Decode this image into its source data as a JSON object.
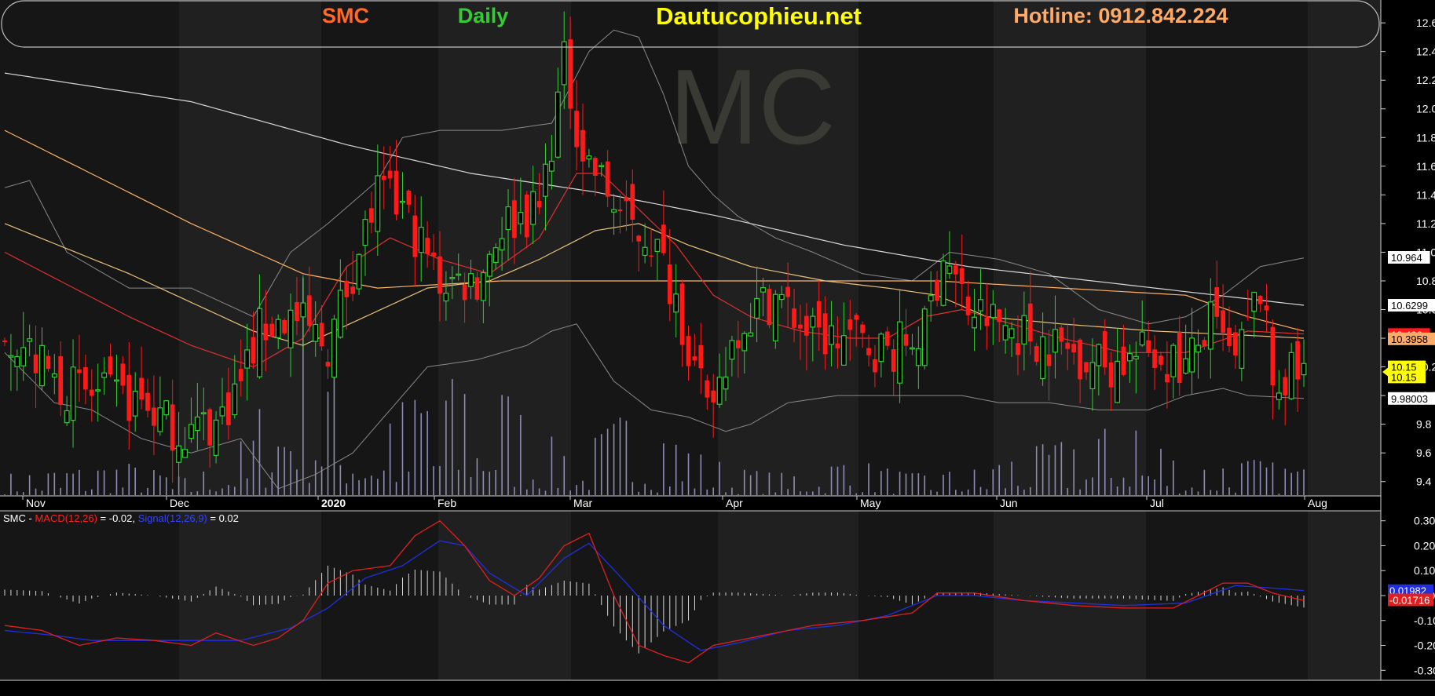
{
  "header": {
    "symbol": "SMC",
    "interval": "Daily",
    "site": "Dautucophieu.net",
    "hotline": "Hotline: 0912.842.224"
  },
  "watermark": "MC",
  "colors": {
    "symbol": "#ff6a2a",
    "interval": "#33cc33",
    "site": "#ffff00",
    "hotline": "#ffaa66",
    "up": "#33cc33",
    "down": "#ff1a1a",
    "ma_red": "#e03030",
    "ma_orange": "#ffb266",
    "ma_tan": "#e8c27a",
    "ma_white": "#d8d8d8",
    "bb": "#8a8a8a",
    "volume": "#8c8cb4",
    "macd": "#e02020",
    "signal": "#2030e0"
  },
  "chart_data": [
    {
      "type": "candlestick",
      "title": "SMC Daily",
      "x_labels": [
        "Nov",
        "Dec",
        "2020",
        "Feb",
        "Mar",
        "Apr",
        "May",
        "Jun",
        "Jul",
        "Aug"
      ],
      "ylim": [
        9.3,
        12.65
      ],
      "y_ticks": [
        "12.6",
        "12.4",
        "12.2",
        "12.0",
        "11.8",
        "11.6",
        "11.4",
        "11.2",
        "11.0",
        "10.8",
        "10.6",
        "10.4",
        "10.2",
        "10.0",
        "9.8",
        "9.6",
        "9.4"
      ],
      "price_labels": [
        {
          "text": "10.964",
          "value": 10.964,
          "bg": "#ffffff",
          "fg": "#000000"
        },
        {
          "text": "10.6299",
          "value": 10.6299,
          "bg": "#ffffff",
          "fg": "#000000"
        },
        {
          "text": "10.426",
          "value": 10.426,
          "bg": "#ff1a1a",
          "fg": "#ffffff"
        },
        {
          "text": "10.3958",
          "value": 10.3958,
          "bg": "#ffaa66",
          "fg": "#000000"
        },
        {
          "text": "10.15",
          "value": 10.2,
          "bg": "#ffff00",
          "fg": "#000000"
        },
        {
          "text": "10.15",
          "value": 10.13,
          "bg": "#ffff00",
          "fg": "#000000"
        },
        {
          "text": "9.98003",
          "value": 9.98003,
          "bg": "#ffffff",
          "fg": "#000000"
        }
      ],
      "series_anchors": {
        "close": [
          [
            0,
            10.5
          ],
          [
            8,
            10.1
          ],
          [
            14,
            10.0
          ],
          [
            22,
            9.95
          ],
          [
            28,
            9.75
          ],
          [
            34,
            9.8
          ],
          [
            38,
            10.1
          ],
          [
            41,
            10.45
          ],
          [
            46,
            10.55
          ],
          [
            52,
            10.35
          ],
          [
            55,
            10.75
          ],
          [
            60,
            11.4
          ],
          [
            64,
            11.3
          ],
          [
            70,
            10.8
          ],
          [
            76,
            10.8
          ],
          [
            80,
            11.2
          ],
          [
            86,
            11.3
          ],
          [
            90,
            12.3
          ],
          [
            93,
            11.7
          ],
          [
            100,
            11.2
          ],
          [
            104,
            11.1
          ],
          [
            108,
            10.7
          ],
          [
            110,
            10.35
          ],
          [
            113,
            9.85
          ],
          [
            118,
            10.5
          ],
          [
            124,
            10.7
          ],
          [
            130,
            10.4
          ],
          [
            136,
            10.4
          ],
          [
            142,
            10.3
          ],
          [
            148,
            10.45
          ],
          [
            151,
            11.0
          ],
          [
            155,
            10.6
          ],
          [
            160,
            10.5
          ],
          [
            166,
            10.4
          ],
          [
            172,
            10.3
          ],
          [
            178,
            10.2
          ],
          [
            184,
            10.3
          ],
          [
            190,
            10.2
          ],
          [
            194,
            10.5
          ],
          [
            198,
            10.2
          ],
          [
            202,
            10.75
          ],
          [
            204,
            10.1
          ],
          [
            209,
            10.15
          ]
        ],
        "ma20": [
          [
            0,
            11.0
          ],
          [
            20,
            10.55
          ],
          [
            30,
            10.35
          ],
          [
            40,
            10.2
          ],
          [
            48,
            10.4
          ],
          [
            55,
            10.9
          ],
          [
            62,
            11.1
          ],
          [
            70,
            10.95
          ],
          [
            78,
            10.85
          ],
          [
            86,
            11.1
          ],
          [
            92,
            11.55
          ],
          [
            96,
            11.55
          ],
          [
            102,
            11.3
          ],
          [
            108,
            11.05
          ],
          [
            114,
            10.7
          ],
          [
            120,
            10.55
          ],
          [
            128,
            10.45
          ],
          [
            136,
            10.4
          ],
          [
            142,
            10.4
          ],
          [
            148,
            10.55
          ],
          [
            154,
            10.6
          ],
          [
            162,
            10.5
          ],
          [
            170,
            10.4
          ],
          [
            180,
            10.3
          ],
          [
            190,
            10.3
          ],
          [
            200,
            10.45
          ],
          [
            209,
            10.43
          ]
        ],
        "ma50": [
          [
            0,
            11.2
          ],
          [
            20,
            10.85
          ],
          [
            40,
            10.45
          ],
          [
            48,
            10.35
          ],
          [
            58,
            10.55
          ],
          [
            68,
            10.75
          ],
          [
            78,
            10.8
          ],
          [
            86,
            10.95
          ],
          [
            95,
            11.15
          ],
          [
            102,
            11.2
          ],
          [
            110,
            11.05
          ],
          [
            120,
            10.9
          ],
          [
            132,
            10.8
          ],
          [
            142,
            10.75
          ],
          [
            150,
            10.7
          ],
          [
            158,
            10.55
          ],
          [
            170,
            10.5
          ],
          [
            185,
            10.45
          ],
          [
            200,
            10.42
          ],
          [
            209,
            10.4
          ]
        ],
        "ma100": [
          [
            0,
            11.85
          ],
          [
            30,
            11.2
          ],
          [
            48,
            10.85
          ],
          [
            60,
            10.75
          ],
          [
            80,
            10.8
          ],
          [
            95,
            10.8
          ],
          [
            110,
            10.8
          ],
          [
            130,
            10.8
          ],
          [
            150,
            10.8
          ],
          [
            170,
            10.75
          ],
          [
            190,
            10.7
          ],
          [
            200,
            10.55
          ],
          [
            209,
            10.45
          ]
        ],
        "ma200": [
          [
            0,
            12.25
          ],
          [
            30,
            12.05
          ],
          [
            55,
            11.75
          ],
          [
            75,
            11.55
          ],
          [
            95,
            11.42
          ],
          [
            115,
            11.25
          ],
          [
            135,
            11.05
          ],
          [
            155,
            10.9
          ],
          [
            175,
            10.8
          ],
          [
            195,
            10.7
          ],
          [
            209,
            10.63
          ]
        ],
        "bb_upper": [
          [
            0,
            11.45
          ],
          [
            4,
            11.5
          ],
          [
            10,
            11.0
          ],
          [
            20,
            10.75
          ],
          [
            30,
            10.75
          ],
          [
            40,
            10.55
          ],
          [
            46,
            11.0
          ],
          [
            52,
            11.2
          ],
          [
            60,
            11.5
          ],
          [
            64,
            11.8
          ],
          [
            70,
            11.85
          ],
          [
            80,
            11.85
          ],
          [
            88,
            11.9
          ],
          [
            94,
            12.4
          ],
          [
            98,
            12.55
          ],
          [
            102,
            12.5
          ],
          [
            106,
            12.1
          ],
          [
            110,
            11.6
          ],
          [
            114,
            11.4
          ],
          [
            118,
            11.25
          ],
          [
            124,
            11.1
          ],
          [
            130,
            11.0
          ],
          [
            138,
            10.85
          ],
          [
            146,
            10.8
          ],
          [
            152,
            11.0
          ],
          [
            160,
            10.95
          ],
          [
            168,
            10.85
          ],
          [
            176,
            10.6
          ],
          [
            184,
            10.5
          ],
          [
            190,
            10.55
          ],
          [
            196,
            10.7
          ],
          [
            202,
            10.9
          ],
          [
            209,
            10.96
          ]
        ],
        "bb_lower": [
          [
            0,
            10.3
          ],
          [
            8,
            9.95
          ],
          [
            14,
            9.9
          ],
          [
            22,
            9.7
          ],
          [
            30,
            9.6
          ],
          [
            38,
            9.7
          ],
          [
            44,
            9.35
          ],
          [
            50,
            9.45
          ],
          [
            56,
            9.6
          ],
          [
            62,
            9.9
          ],
          [
            68,
            10.2
          ],
          [
            76,
            10.25
          ],
          [
            84,
            10.35
          ],
          [
            88,
            10.45
          ],
          [
            92,
            10.5
          ],
          [
            98,
            10.1
          ],
          [
            104,
            9.9
          ],
          [
            110,
            9.85
          ],
          [
            116,
            9.75
          ],
          [
            120,
            9.8
          ],
          [
            126,
            9.95
          ],
          [
            134,
            10.0
          ],
          [
            142,
            10.0
          ],
          [
            148,
            10.0
          ],
          [
            154,
            10.0
          ],
          [
            160,
            9.95
          ],
          [
            168,
            9.95
          ],
          [
            176,
            9.9
          ],
          [
            184,
            9.9
          ],
          [
            190,
            10.0
          ],
          [
            196,
            10.05
          ],
          [
            200,
            10.0
          ],
          [
            209,
            9.98
          ]
        ],
        "volume": [
          [
            0,
            20
          ],
          [
            20,
            30
          ],
          [
            30,
            15
          ],
          [
            40,
            60
          ],
          [
            44,
            160
          ],
          [
            48,
            210
          ],
          [
            52,
            120
          ],
          [
            58,
            80
          ],
          [
            64,
            90
          ],
          [
            72,
            110
          ],
          [
            78,
            120
          ],
          [
            86,
            60
          ],
          [
            92,
            40
          ],
          [
            100,
            80
          ],
          [
            104,
            70
          ],
          [
            112,
            40
          ],
          [
            118,
            25
          ],
          [
            126,
            20
          ],
          [
            136,
            35
          ],
          [
            146,
            20
          ],
          [
            156,
            25
          ],
          [
            166,
            45
          ],
          [
            176,
            60
          ],
          [
            182,
            75
          ],
          [
            190,
            25
          ],
          [
            200,
            35
          ],
          [
            209,
            25
          ]
        ]
      }
    },
    {
      "type": "line",
      "title": "SMC - MACD(12,26) = -0.02, Signal(12,26,9) = 0.02",
      "legend": {
        "prefix": "SMC - ",
        "macd_name": "MACD(12,26)",
        "macd_value": " = -0.02, ",
        "signal_name": "Signal(12,26,9)",
        "signal_value": " = 0.02"
      },
      "ylim": [
        -0.34,
        0.34
      ],
      "y_ticks": [
        "0.30",
        "0.20",
        "0.10",
        "0.00",
        "-0.10",
        "-0.20",
        "-0.30"
      ],
      "value_labels": [
        {
          "text": "0.01982",
          "value": 0.01982,
          "bg": "#2030e0",
          "fg": "#ffffff"
        },
        {
          "text": "-0.01716",
          "value": -0.01716,
          "bg": "#e02020",
          "fg": "#ffffff"
        }
      ],
      "series_anchors": {
        "macd": [
          [
            0,
            -0.12
          ],
          [
            6,
            -0.14
          ],
          [
            12,
            -0.2
          ],
          [
            18,
            -0.17
          ],
          [
            24,
            -0.18
          ],
          [
            30,
            -0.2
          ],
          [
            34,
            -0.15
          ],
          [
            40,
            -0.2
          ],
          [
            44,
            -0.17
          ],
          [
            48,
            -0.1
          ],
          [
            52,
            0.05
          ],
          [
            56,
            0.1
          ],
          [
            62,
            0.12
          ],
          [
            66,
            0.24
          ],
          [
            70,
            0.3
          ],
          [
            74,
            0.2
          ],
          [
            78,
            0.06
          ],
          [
            82,
            0.0
          ],
          [
            86,
            0.07
          ],
          [
            90,
            0.2
          ],
          [
            94,
            0.25
          ],
          [
            98,
            0.0
          ],
          [
            102,
            -0.2
          ],
          [
            106,
            -0.24
          ],
          [
            110,
            -0.27
          ],
          [
            114,
            -0.2
          ],
          [
            118,
            -0.18
          ],
          [
            124,
            -0.15
          ],
          [
            130,
            -0.12
          ],
          [
            138,
            -0.1
          ],
          [
            146,
            -0.07
          ],
          [
            150,
            0.01
          ],
          [
            156,
            0.01
          ],
          [
            164,
            -0.02
          ],
          [
            172,
            -0.04
          ],
          [
            180,
            -0.05
          ],
          [
            188,
            -0.05
          ],
          [
            196,
            0.05
          ],
          [
            200,
            0.05
          ],
          [
            204,
            0.01
          ],
          [
            209,
            -0.02
          ]
        ],
        "signal": [
          [
            0,
            -0.14
          ],
          [
            8,
            -0.16
          ],
          [
            14,
            -0.18
          ],
          [
            22,
            -0.18
          ],
          [
            30,
            -0.18
          ],
          [
            38,
            -0.18
          ],
          [
            46,
            -0.13
          ],
          [
            52,
            -0.05
          ],
          [
            58,
            0.07
          ],
          [
            64,
            0.12
          ],
          [
            70,
            0.22
          ],
          [
            74,
            0.2
          ],
          [
            78,
            0.09
          ],
          [
            84,
            0.0
          ],
          [
            90,
            0.15
          ],
          [
            94,
            0.21
          ],
          [
            100,
            0.05
          ],
          [
            106,
            -0.12
          ],
          [
            112,
            -0.22
          ],
          [
            118,
            -0.19
          ],
          [
            126,
            -0.14
          ],
          [
            134,
            -0.12
          ],
          [
            142,
            -0.08
          ],
          [
            150,
            0.0
          ],
          [
            156,
            0.0
          ],
          [
            164,
            -0.02
          ],
          [
            172,
            -0.03
          ],
          [
            180,
            -0.04
          ],
          [
            190,
            -0.03
          ],
          [
            198,
            0.04
          ],
          [
            204,
            0.03
          ],
          [
            209,
            0.02
          ]
        ]
      }
    }
  ]
}
